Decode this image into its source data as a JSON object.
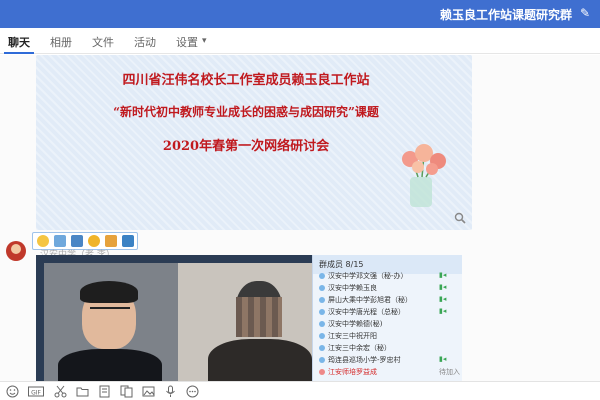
{
  "window": {
    "title": "赖玉良工作站课题研究群",
    "edit_icon": "edit-icon"
  },
  "tabs": [
    {
      "label": "聊天",
      "active": true
    },
    {
      "label": "相册"
    },
    {
      "label": "文件"
    },
    {
      "label": "活动"
    },
    {
      "label": "设置"
    }
  ],
  "settings_chevron": "chevron-down-icon",
  "banner": {
    "line1": "四川省汪伟名校长工作室成员赖玉良工作站",
    "line2": "“新时代初中教师专业成长的困惑与成因研究”课题",
    "line3": "2020年春第一次网络研讨会"
  },
  "message": {
    "sender": "汉安中学（老 李）",
    "emoji_toolbar": [
      "emoji-icon",
      "screenshot-icon",
      "image-icon",
      "smile-icon",
      "folder-icon",
      "favorite-icon"
    ]
  },
  "conference": {
    "panel_title": "群成员 8/15",
    "members": [
      {
        "name": "汉安中学邓文强（秘-办）",
        "highlight": false
      },
      {
        "name": "汉安中学赖玉良",
        "highlight": false
      },
      {
        "name": "屏山大乘中学彭旭君（秘）",
        "highlight": false
      },
      {
        "name": "汉安中学唐光程（总秘）",
        "highlight": false
      },
      {
        "name": "汉安中学赖德(秘)",
        "highlight": false
      },
      {
        "name": "江安三中祝开阳",
        "highlight": false
      },
      {
        "name": "江安三中余宏（秘）",
        "highlight": false
      },
      {
        "name": "筠连县巡场小学-罗忠村",
        "highlight": false
      },
      {
        "name": "江安师培罗益成",
        "highlight": true
      }
    ],
    "status_label": "待加入"
  },
  "bottom_toolbar": [
    "emoji-icon",
    "gif-icon",
    "scissors-icon",
    "folder-icon",
    "file-icon",
    "doc-icon",
    "image-icon",
    "mic-icon",
    "more-icon"
  ],
  "colors": {
    "titlebar": "#3f6fd0",
    "accent": "#2f6bd8",
    "banner_text": "#c0191e"
  }
}
